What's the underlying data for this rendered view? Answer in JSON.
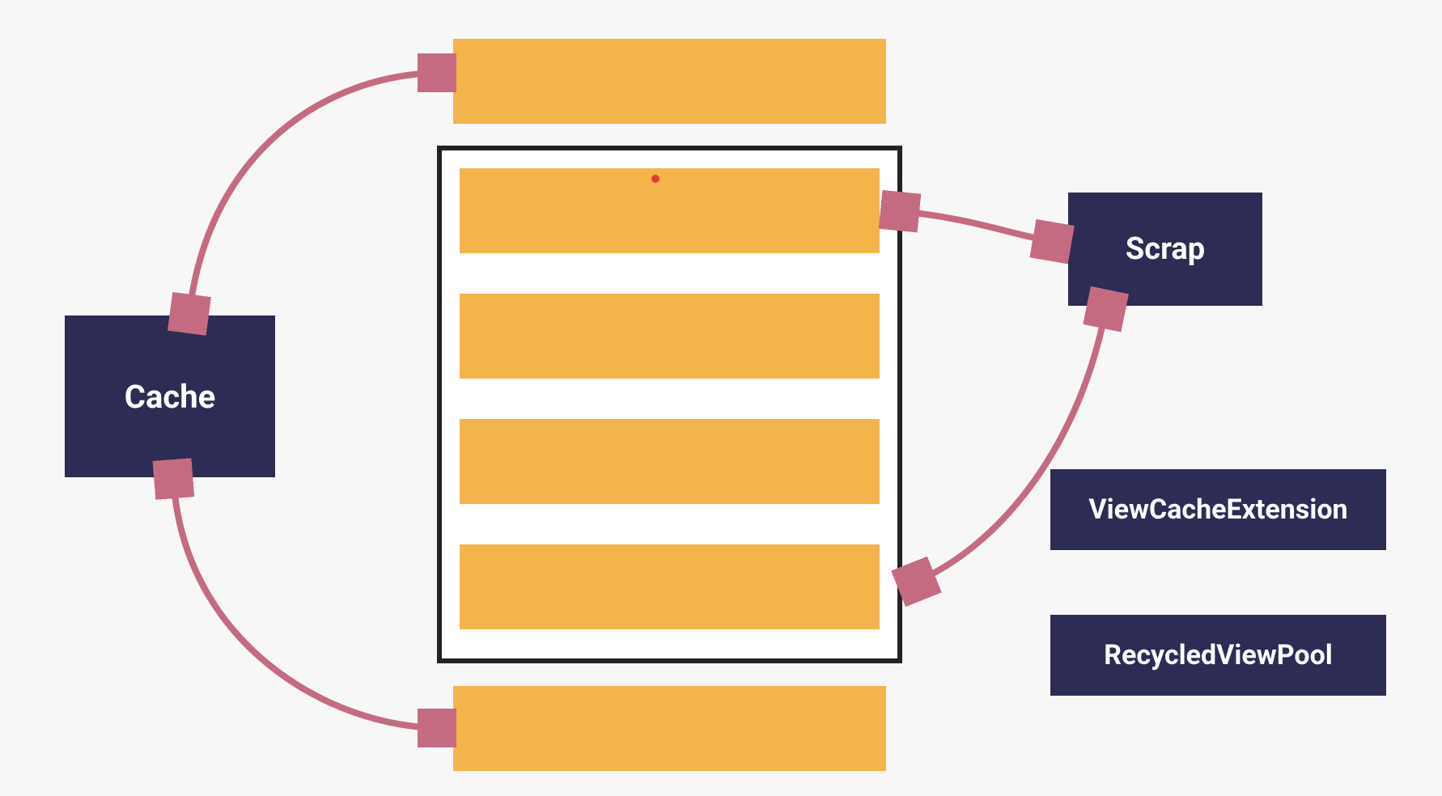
{
  "diagram": {
    "cache_label": "Cache",
    "scrap_label": "Scrap",
    "view_cache_extension_label": "ViewCacheExtension",
    "recycled_view_pool_label": "RecycledViewPool"
  },
  "colors": {
    "navy": "#2c2c54",
    "orange": "#f2b44b",
    "arrow": "#c46b82",
    "cursor_dot": "#e53935"
  },
  "layout": {
    "offscreen_item_count_top": 1,
    "offscreen_item_count_bottom": 1,
    "visible_item_count": 4,
    "arrows": [
      {
        "from": "cache",
        "to": "offscreen-top",
        "bidirectional": true
      },
      {
        "from": "cache",
        "to": "offscreen-bottom",
        "bidirectional": true
      },
      {
        "from": "scrap",
        "to": "visible-first",
        "bidirectional": true
      },
      {
        "from": "scrap",
        "to": "visible-last",
        "bidirectional": false
      }
    ]
  }
}
